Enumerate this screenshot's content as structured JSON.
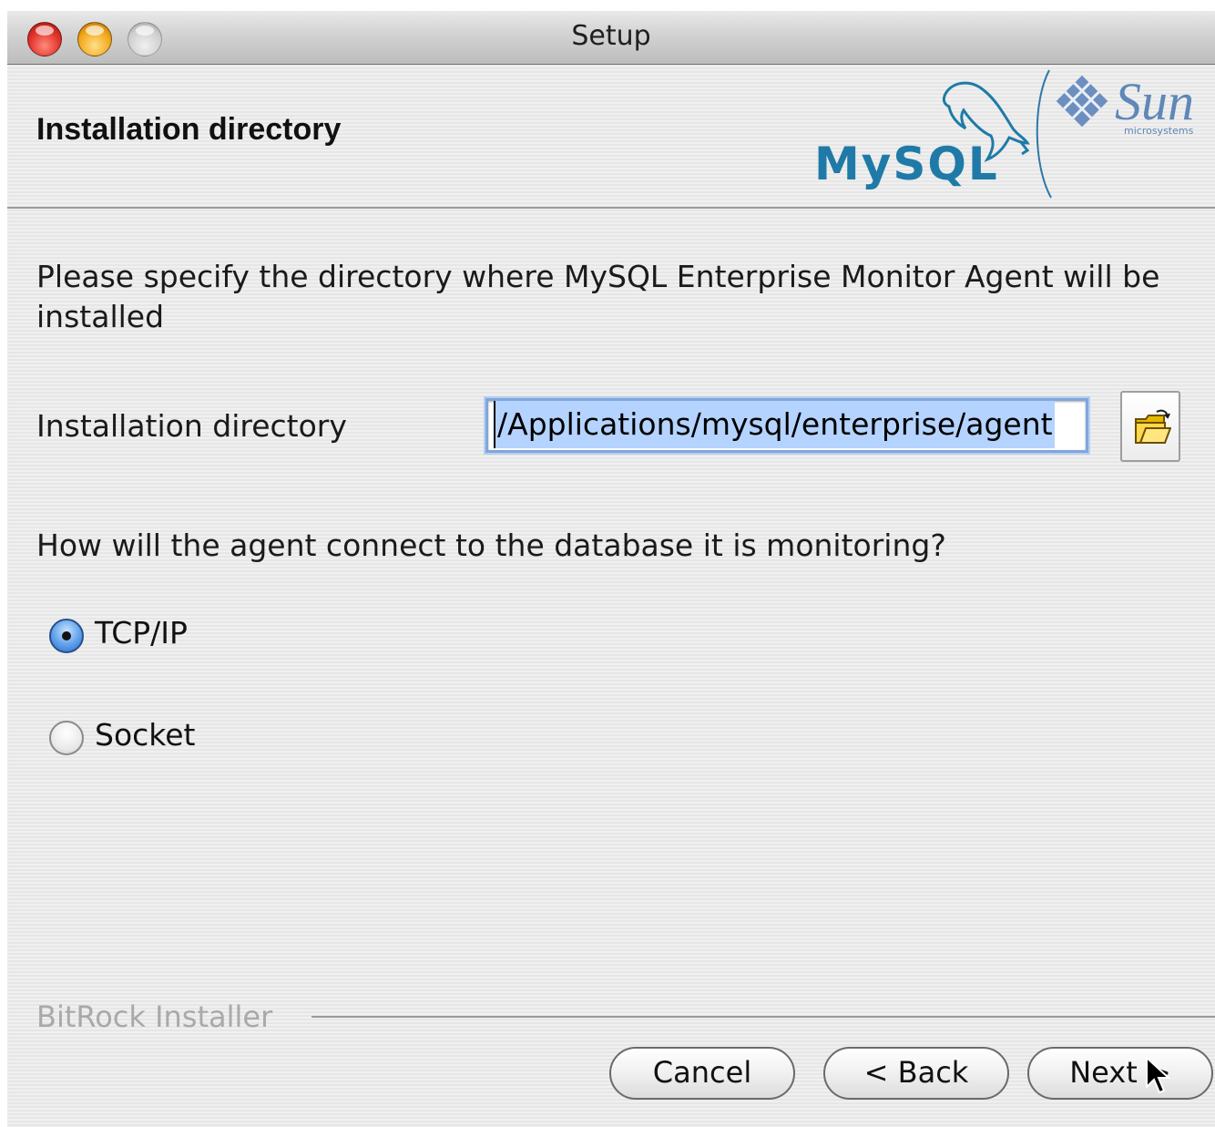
{
  "window": {
    "title": "Setup"
  },
  "header": {
    "title": "Installation directory",
    "logo_left": "MySQL",
    "logo_right": "Sun",
    "logo_right_sub": "microsystems"
  },
  "content": {
    "description": "Please specify the directory where MySQL Enterprise Monitor Agent will be installed",
    "directory_label": "Installation directory",
    "directory_value": "/Applications/mysql/enterprise/agent",
    "browse_icon": "folder-open-icon",
    "question": "How will the agent connect to the database it is monitoring?",
    "options": [
      {
        "label": "TCP/IP",
        "selected": true
      },
      {
        "label": "Socket",
        "selected": false
      }
    ]
  },
  "footer": {
    "brand": "BitRock Installer",
    "buttons": {
      "cancel": "Cancel",
      "back": "< Back",
      "next": "Next >"
    }
  },
  "colors": {
    "mysql_blue": "#1f7aa8",
    "mysql_orange": "#e48e00",
    "sun_blue": "#5f87b8",
    "selection": "#b5d3ff",
    "focus_ring": "#7fa7dd"
  }
}
